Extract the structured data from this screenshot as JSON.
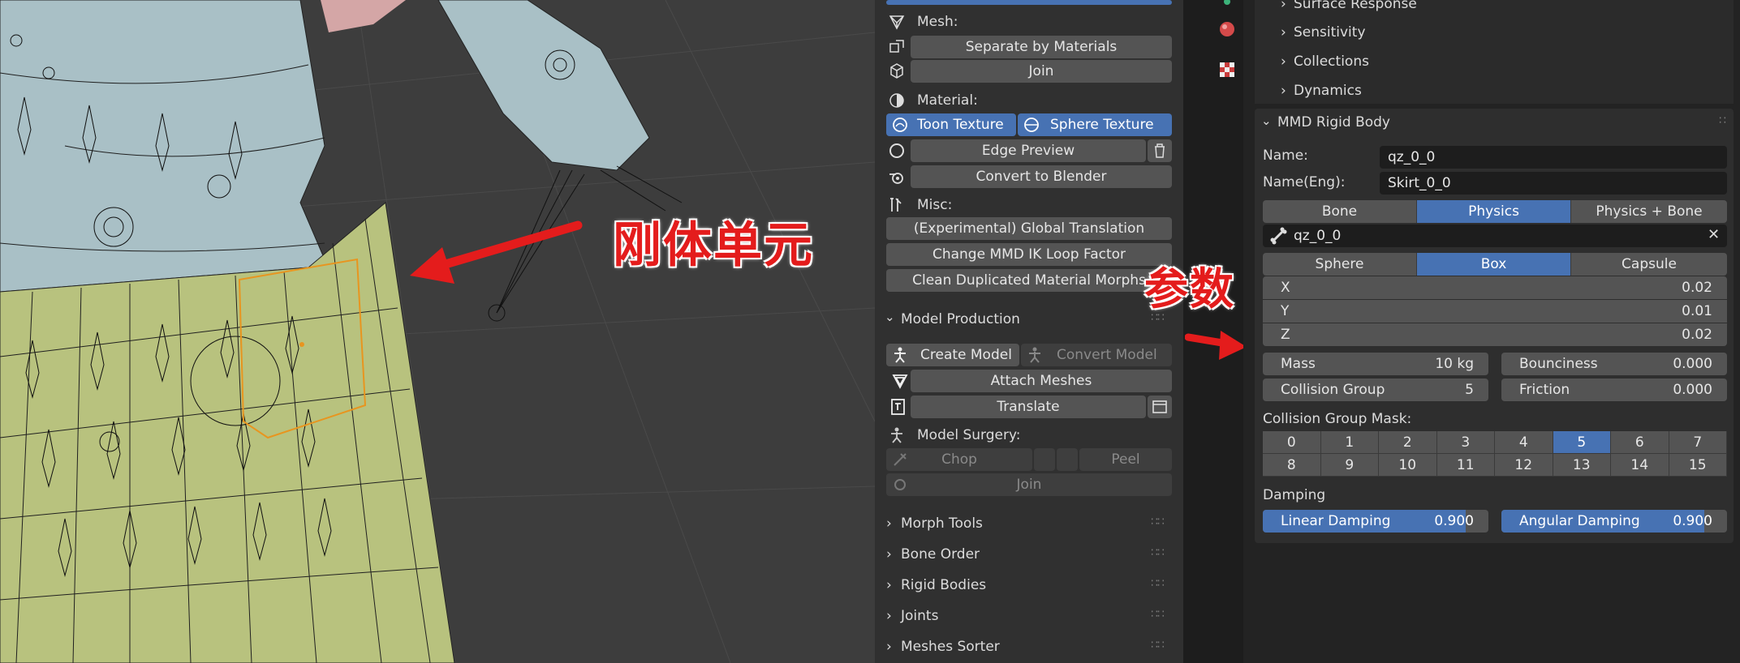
{
  "annotations": {
    "rigid_unit": "刚体单元",
    "params": "参数"
  },
  "mmd_tools": {
    "mesh_header": "Mesh:",
    "separate_by_materials": "Separate by Materials",
    "join": "Join",
    "material_header": "Material:",
    "toon_texture": "Toon Texture",
    "sphere_texture": "Sphere Texture",
    "edge_preview": "Edge Preview",
    "convert_to_blender": "Convert to Blender",
    "misc_header": "Misc:",
    "global_translation": "(Experimental) Global Translation",
    "change_ik_loop": "Change MMD IK Loop Factor",
    "clean_morphs": "Clean Duplicated Material Morphs",
    "model_production": "Model Production",
    "create_model": "Create Model",
    "convert_model": "Convert Model",
    "attach_meshes": "Attach Meshes",
    "translate": "Translate",
    "model_surgery": "Model Surgery:",
    "chop": "Chop",
    "peel": "Peel",
    "surgery_join": "Join",
    "collapsed": [
      "Morph Tools",
      "Bone Order",
      "Rigid Bodies",
      "Joints",
      "Meshes Sorter"
    ]
  },
  "properties": {
    "subsections": [
      "Surface Response",
      "Sensitivity",
      "Collections",
      "Dynamics"
    ],
    "panel_title": "MMD Rigid Body",
    "name_label": "Name:",
    "name_value": "qz_0_0",
    "name_eng_label": "Name(Eng):",
    "name_eng_value": "Skirt_0_0",
    "type_tabs": [
      "Bone",
      "Physics",
      "Physics + Bone"
    ],
    "type_active": "Physics",
    "bone_value": "qz_0_0",
    "shape_tabs": [
      "Sphere",
      "Box",
      "Capsule"
    ],
    "shape_active": "Box",
    "size": {
      "x_label": "X",
      "x": "0.02",
      "y_label": "Y",
      "y": "0.01",
      "z_label": "Z",
      "z": "0.02"
    },
    "mass_label": "Mass",
    "mass": "10 kg",
    "bounciness_label": "Bounciness",
    "bounciness": "0.000",
    "collision_group_label": "Collision Group",
    "collision_group": "5",
    "friction_label": "Friction",
    "friction": "0.000",
    "mask_label": "Collision Group Mask:",
    "mask_row1": [
      "0",
      "1",
      "2",
      "3",
      "4",
      "5",
      "6",
      "7"
    ],
    "mask_row2": [
      "8",
      "9",
      "10",
      "11",
      "12",
      "13",
      "14",
      "15"
    ],
    "mask_active": "5",
    "damping_label": "Damping",
    "linear_damping_label": "Linear Damping",
    "linear_damping": "0.900",
    "linear_damping_fraction": 0.9,
    "angular_damping_label": "Angular Damping",
    "angular_damping": "0.900",
    "angular_damping_fraction": 0.9
  },
  "colors": {
    "accent": "#4772b3",
    "annotation": "#e41c1c",
    "skirt": "#b8c27e",
    "body": "#a9c0c6"
  }
}
